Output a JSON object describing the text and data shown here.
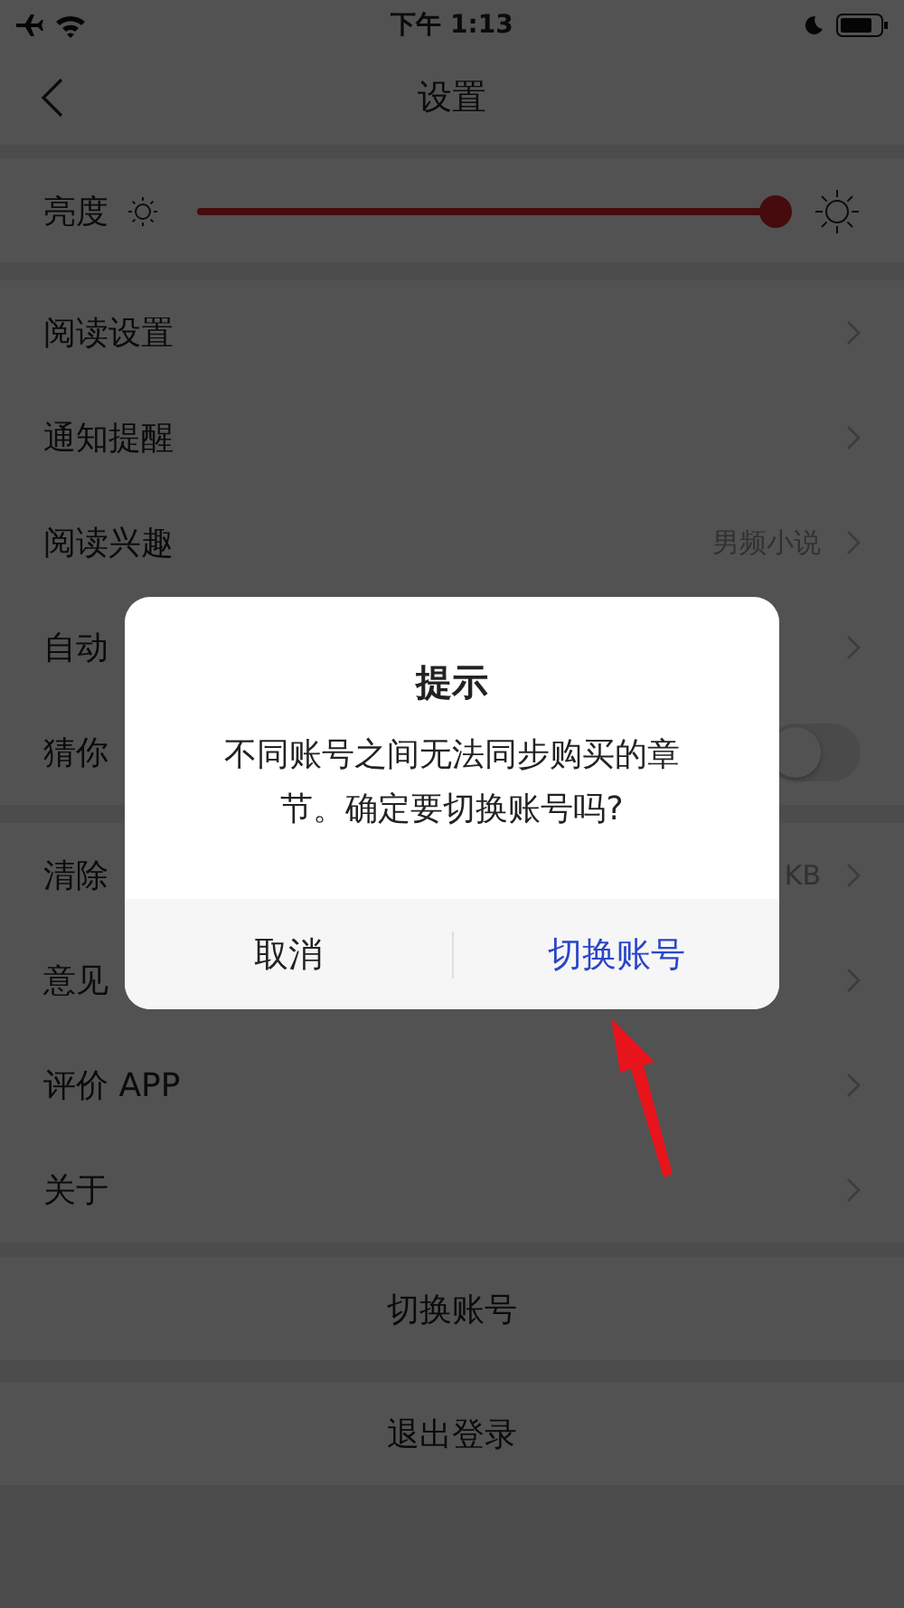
{
  "status_bar": {
    "time": "下午 1:13"
  },
  "nav": {
    "title": "设置"
  },
  "brightness": {
    "label": "亮度",
    "level": 1
  },
  "sections": [
    [
      {
        "kind": "link",
        "label": "阅读设置"
      },
      {
        "kind": "link",
        "label": "通知提醒"
      },
      {
        "kind": "link",
        "label": "阅读兴趣",
        "value": "男频小说"
      },
      {
        "kind": "link",
        "label": "自动"
      },
      {
        "kind": "toggle",
        "label": "猜你",
        "on": false
      }
    ],
    [
      {
        "kind": "link",
        "label": "清除",
        "value": "KB"
      },
      {
        "kind": "link",
        "label": "意见"
      },
      {
        "kind": "link",
        "label": "评价 APP"
      },
      {
        "kind": "link",
        "label": "关于"
      }
    ]
  ],
  "buttons": [
    "切换账号",
    "退出登录"
  ],
  "dialog": {
    "title": "提示",
    "message": "不同账号之间无法同步购买的章节。确定要切换账号吗?",
    "actions": [
      {
        "label": "取消",
        "kind": "cancel"
      },
      {
        "label": "切换账号",
        "kind": "confirm"
      }
    ]
  }
}
